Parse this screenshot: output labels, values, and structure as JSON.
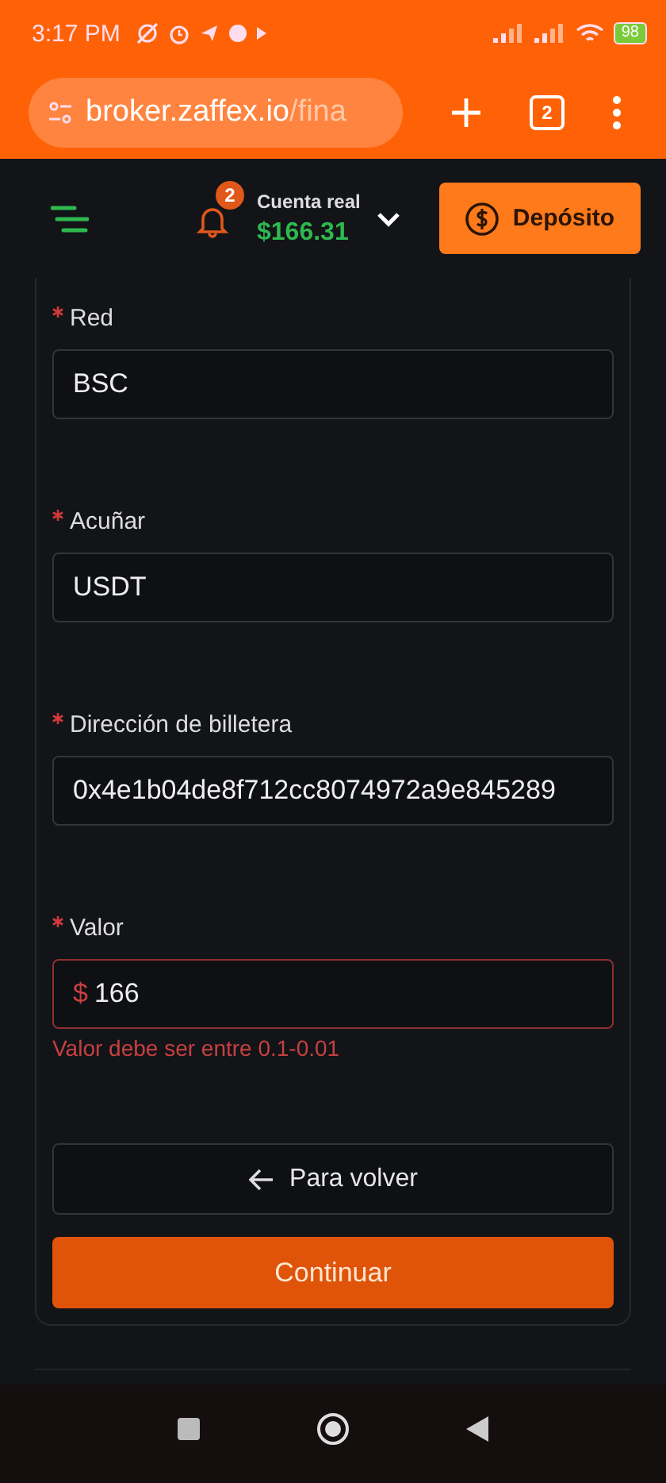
{
  "status_bar": {
    "time": "3:17 PM",
    "battery": "98"
  },
  "browser": {
    "url_host": "broker.zaffex.io",
    "url_path": "/fina",
    "tab_count": "2"
  },
  "header": {
    "notification_count": "2",
    "account_label": "Cuenta real",
    "balance": "$166.31",
    "deposit_button": "Depósito"
  },
  "form": {
    "fields": [
      {
        "label": "Red",
        "required": true,
        "value": "BSC",
        "error": false
      },
      {
        "label": "Acuñar",
        "required": true,
        "value": "USDT",
        "error": false
      },
      {
        "label": "Dirección de billetera",
        "required": true,
        "value": "0x4e1b04de8f712cc8074972a9e845289",
        "error": false
      },
      {
        "label": "Valor",
        "required": true,
        "prefix": "$",
        "value": "166",
        "error": true,
        "error_message": "Valor debe ser entre 0.1-0.01"
      }
    ],
    "back_button": "Para volver",
    "continue_button": "Continuar"
  }
}
